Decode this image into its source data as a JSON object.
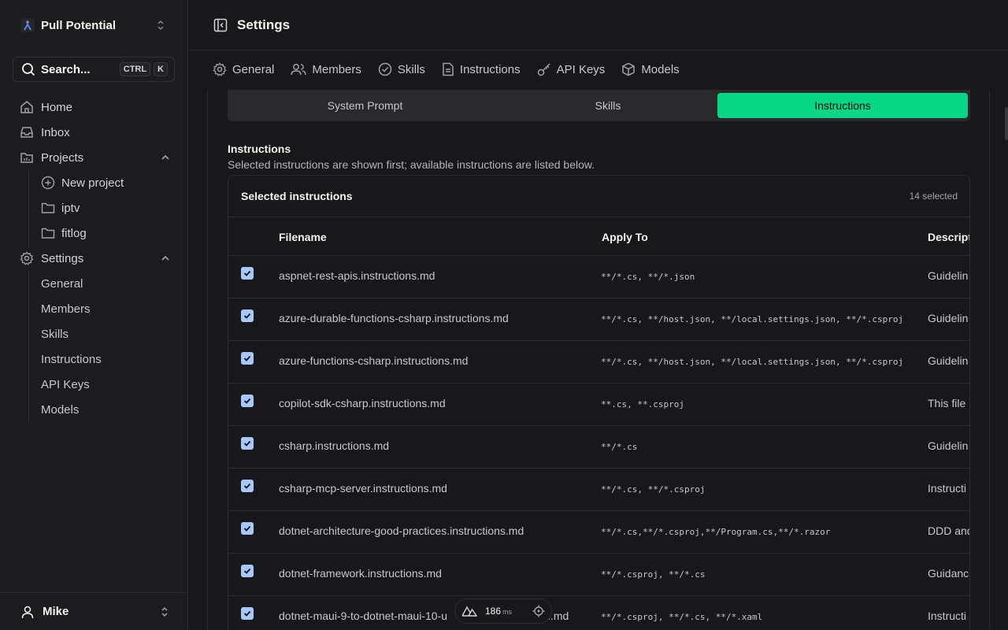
{
  "workspace": {
    "name": "Pull Potential"
  },
  "search": {
    "label": "Search...",
    "kbd1": "CTRL",
    "kbd2": "K"
  },
  "nav": {
    "home": "Home",
    "inbox": "Inbox",
    "projects": "Projects",
    "new_project": "New project",
    "project1": "iptv",
    "project2": "fitlog",
    "settings": "Settings",
    "settings_items": [
      "General",
      "Members",
      "Skills",
      "Instructions",
      "API Keys",
      "Models"
    ]
  },
  "user": {
    "name": "Mike"
  },
  "header": {
    "title": "Settings"
  },
  "tabs": [
    "General",
    "Members",
    "Skills",
    "Instructions",
    "API Keys",
    "Models"
  ],
  "segment": {
    "options": [
      "System Prompt",
      "Skills",
      "Instructions"
    ],
    "active": "Instructions"
  },
  "section": {
    "title": "Instructions",
    "description": "Selected instructions are shown first; available instructions are listed below."
  },
  "panel": {
    "title": "Selected instructions",
    "count": "14 selected"
  },
  "table": {
    "headers": {
      "filename": "Filename",
      "apply_to": "Apply To",
      "description": "Descript"
    },
    "rows": [
      {
        "checked": true,
        "filename": "aspnet-rest-apis.instructions.md",
        "apply_to": "**/*.cs, **/*.json",
        "description": "Guidelin"
      },
      {
        "checked": true,
        "filename": "azure-durable-functions-csharp.instructions.md",
        "apply_to": "**/*.cs, **/host.json, **/local.settings.json, **/*.csproj",
        "description": "Guidelin"
      },
      {
        "checked": true,
        "filename": "azure-functions-csharp.instructions.md",
        "apply_to": "**/*.cs, **/host.json, **/local.settings.json, **/*.csproj",
        "description": "Guidelin"
      },
      {
        "checked": true,
        "filename": "copilot-sdk-csharp.instructions.md",
        "apply_to": "**.cs, **.csproj",
        "description": "This file"
      },
      {
        "checked": true,
        "filename": "csharp.instructions.md",
        "apply_to": "**/*.cs",
        "description": "Guidelin"
      },
      {
        "checked": true,
        "filename": "csharp-mcp-server.instructions.md",
        "apply_to": "**/*.cs, **/*.csproj",
        "description": "Instructi"
      },
      {
        "checked": true,
        "filename": "dotnet-architecture-good-practices.instructions.md",
        "apply_to": "**/*.cs,**/*.csproj,**/Program.cs,**/*.razor",
        "description": "DDD and"
      },
      {
        "checked": true,
        "filename": "dotnet-framework.instructions.md",
        "apply_to": "**/*.csproj, **/*.cs",
        "description": "Guidanc"
      },
      {
        "checked": true,
        "filename": "dotnet-maui-9-to-dotnet-maui-10-u",
        "filename_tail": "s.md",
        "apply_to": "**/*.csproj, **/*.cs, **/*.xaml",
        "description": "Instructi"
      }
    ]
  },
  "devtool": {
    "value": "186",
    "unit": "ms"
  },
  "colors": {
    "accent": "#06d685",
    "checkbox": "#a6c8ff",
    "background": "#18181a"
  }
}
